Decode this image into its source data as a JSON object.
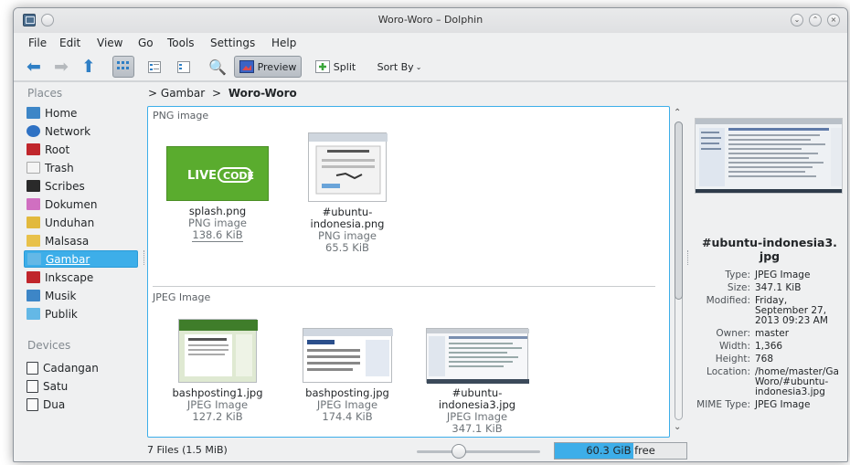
{
  "window": {
    "title": "Woro-Woro – Dolphin",
    "buttons": [
      "minimize",
      "maximize",
      "close"
    ]
  },
  "menubar": [
    "File",
    "Edit",
    "View",
    "Go",
    "Tools",
    "Settings",
    "Help"
  ],
  "toolbar": {
    "preview_label": "Preview",
    "split_label": "Split",
    "sort_label": "Sort By",
    "icons": [
      "back-icon",
      "forward-icon",
      "up-icon",
      "icons-view-icon",
      "compact-view-icon",
      "details-view-icon",
      "find-icon",
      "preview-icon",
      "split-icon"
    ]
  },
  "sidebar": {
    "places_title": "Places",
    "places": [
      {
        "label": "Home",
        "icon": "home-folder-icon",
        "color": "#3d86c7"
      },
      {
        "label": "Network",
        "icon": "network-globe-icon",
        "color": "#2f72c4"
      },
      {
        "label": "Root",
        "icon": "root-folder-icon",
        "color": "#c0262c"
      },
      {
        "label": "Trash",
        "icon": "trash-icon",
        "color": "#dcdcdc"
      },
      {
        "label": "Scribes",
        "icon": "folder-dark-icon",
        "color": "#2a2a2a"
      },
      {
        "label": "Dokumen",
        "icon": "folder-pink-icon",
        "color": "#d06fc1"
      },
      {
        "label": "Unduhan",
        "icon": "folder-yellow-icon",
        "color": "#e2b93d"
      },
      {
        "label": "Malsasa",
        "icon": "folder-yellow-icon",
        "color": "#e8c14a"
      },
      {
        "label": "Gambar",
        "icon": "folder-blue-icon",
        "color": "#64b8e6"
      },
      {
        "label": "Inkscape",
        "icon": "folder-red-icon",
        "color": "#c0262c"
      },
      {
        "label": "Musik",
        "icon": "music-folder-icon",
        "color": "#3d86c7"
      },
      {
        "label": "Publik",
        "icon": "folder-blue-icon",
        "color": "#64b8e6"
      }
    ],
    "active_place": "Gambar",
    "devices_title": "Devices",
    "devices": [
      {
        "label": "Cadangan",
        "icon": "drive-icon"
      },
      {
        "label": "Satu",
        "icon": "drive-icon"
      },
      {
        "label": "Dua",
        "icon": "drive-icon"
      }
    ]
  },
  "breadcrumb": {
    "parent": "Gambar",
    "current": "Woro-Woro"
  },
  "groups": [
    {
      "title": "PNG image",
      "items": [
        {
          "name": "splash.png",
          "type": "PNG image",
          "size": "138.6 KiB",
          "thumb": "livecode-logo"
        },
        {
          "name": "#ubuntu-indonesia.png",
          "name_lines": [
            "#ubuntu-",
            "indonesia.png"
          ],
          "type": "PNG image",
          "size": "65.5 KiB",
          "thumb": "connect-dialog"
        }
      ]
    },
    {
      "title": "JPEG Image",
      "items": [
        {
          "name": "bashposting1.jpg",
          "type": "JPEG Image",
          "size": "127.2 KiB",
          "thumb": "webpage-green"
        },
        {
          "name": "bashposting.jpg",
          "type": "JPEG Image",
          "size": "174.4 KiB",
          "thumb": "webpage-blue"
        },
        {
          "name": "#ubuntu-indonesia3.jpg",
          "name_lines": [
            "#ubuntu-",
            "indonesia3.jpg"
          ],
          "type": "JPEG Image",
          "size": "347.1 KiB",
          "thumb": "desktop-screenshot"
        }
      ]
    }
  ],
  "info_panel": {
    "title_lines": [
      "#ubuntu-indonesia3.",
      "jpg"
    ],
    "properties": [
      {
        "key": "Type:",
        "value": [
          "JPEG Image"
        ]
      },
      {
        "key": "Size:",
        "value": [
          "347.1 KiB"
        ]
      },
      {
        "key": "Modified:",
        "value": [
          "Friday,",
          "September 27,",
          "2013 09:23 AM"
        ]
      },
      {
        "key": "Owner:",
        "value": [
          "master"
        ]
      },
      {
        "key": "Width:",
        "value": [
          "1,366"
        ]
      },
      {
        "key": "Height:",
        "value": [
          "768"
        ]
      },
      {
        "key": "Location:",
        "value": [
          "/home/master/Ga",
          "Woro/#ubuntu-",
          "indonesia3.jpg"
        ]
      },
      {
        "key": "MIME Type:",
        "value": [
          "JPEG Image"
        ]
      }
    ]
  },
  "status": {
    "text": "7 Files (1.5 MiB)",
    "zoom_fraction": 0.28,
    "free_space": "60.3 GiB free",
    "used_fraction": 0.6
  },
  "colors": {
    "accent": "#3daee9",
    "livecode_green": "#5aac2e"
  }
}
